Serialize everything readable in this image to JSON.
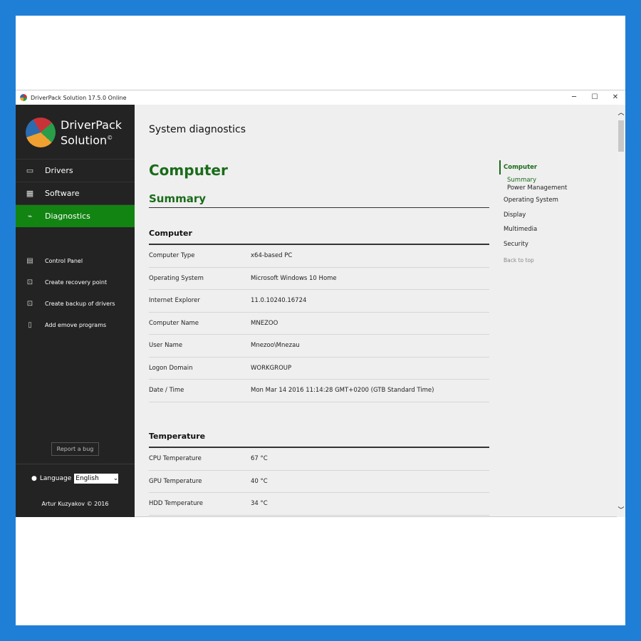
{
  "window": {
    "title": "DriverPack Solution 17.5.0 Online",
    "minimize": "─",
    "maximize": "☐",
    "close": "✕"
  },
  "sidebar": {
    "logo": {
      "line1": "DriverPack",
      "line2": "Solution"
    },
    "nav": [
      {
        "label": "Drivers",
        "icon": "laptop-icon"
      },
      {
        "label": "Software",
        "icon": "grid-icon"
      },
      {
        "label": "Diagnostics",
        "icon": "pulse-icon"
      }
    ],
    "tools": [
      {
        "label": "Control Panel",
        "icon": "control-panel-icon"
      },
      {
        "label": "Create recovery point",
        "icon": "recovery-icon"
      },
      {
        "label": "Create backup of drivers",
        "icon": "backup-icon"
      },
      {
        "label": "Add emove programs",
        "icon": "clipboard-icon"
      }
    ],
    "report_bug": "Report a bug",
    "language_label": "Language",
    "language_value": "English",
    "copyright": "Artur Kuzyakov © 2016"
  },
  "main": {
    "page_title": "System diagnostics",
    "heading": "Computer",
    "subheading": "Summary",
    "computer": {
      "title": "Computer",
      "rows": [
        [
          "Computer Type",
          "x64-based PC"
        ],
        [
          "Operating System",
          "Microsoft Windows 10 Home"
        ],
        [
          "Internet Explorer",
          "11.0.10240.16724"
        ],
        [
          "Computer Name",
          "MNEZOO"
        ],
        [
          "User Name",
          "Mnezoo\\Mnezau"
        ],
        [
          "Logon Domain",
          "WORKGROUP"
        ],
        [
          "Date / Time",
          "Mon Mar 14 2016 11:14:28 GMT+0200 (GTB Standard Time)"
        ]
      ]
    },
    "temperature": {
      "title": "Temperature",
      "rows": [
        [
          "CPU Temperature",
          "67 °C"
        ],
        [
          "GPU Temperature",
          "40 °C"
        ],
        [
          "HDD Temperature",
          "34 °C"
        ]
      ]
    }
  },
  "toc": {
    "computer": "Computer",
    "summary": "Summary",
    "power": "Power Management",
    "os": "Operating System",
    "display": "Display",
    "multimedia": "Multimedia",
    "security": "Security",
    "back": "Back to top"
  }
}
